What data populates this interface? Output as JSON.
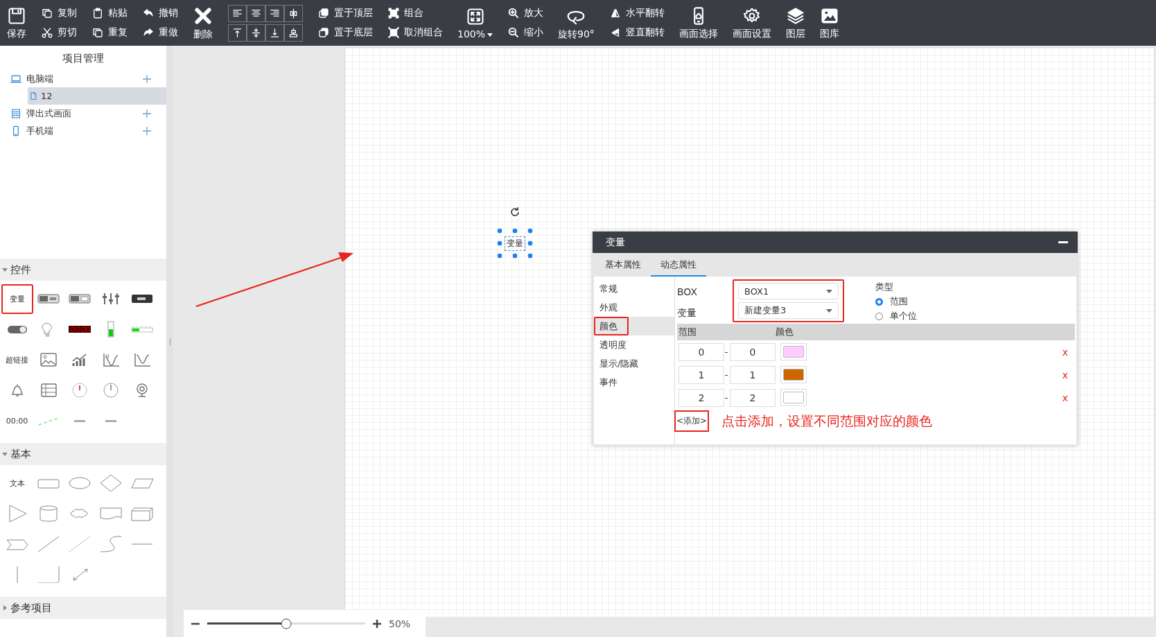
{
  "toolbar": {
    "groups": [
      {
        "kind": "big",
        "items": [
          {
            "label": "保存",
            "kind": "save"
          }
        ]
      },
      {
        "kind": "pair",
        "items": [
          {
            "label": "复制",
            "kind": "copy"
          },
          {
            "label": "剪切",
            "kind": "cut"
          }
        ]
      },
      {
        "kind": "pair",
        "items": [
          {
            "label": "粘贴",
            "kind": "paste"
          },
          {
            "label": "重复",
            "kind": "duplicate"
          }
        ]
      },
      {
        "kind": "pair",
        "items": [
          {
            "label": "撤销",
            "kind": "undo"
          },
          {
            "label": "重做",
            "kind": "redo"
          }
        ]
      },
      {
        "kind": "big",
        "items": [
          {
            "label": "删除",
            "kind": "delete"
          }
        ]
      },
      {
        "kind": "align",
        "items": [
          {
            "kind": "align-left"
          },
          {
            "kind": "align-center"
          },
          {
            "kind": "align-right"
          },
          {
            "kind": "align-hdist"
          },
          {
            "kind": "align-top"
          },
          {
            "kind": "align-middle"
          },
          {
            "kind": "align-bottom"
          },
          {
            "kind": "align-vdist"
          }
        ]
      },
      {
        "kind": "pair",
        "items": [
          {
            "label": "置于顶层",
            "kind": "bring-front"
          },
          {
            "label": "置于底层",
            "kind": "send-back"
          }
        ]
      },
      {
        "kind": "pair",
        "items": [
          {
            "label": "组合",
            "kind": "group"
          },
          {
            "label": "取消组合",
            "kind": "ungroup"
          }
        ]
      },
      {
        "kind": "big",
        "items": [
          {
            "label": "100%",
            "kind": "fit",
            "dropdown": true
          }
        ]
      },
      {
        "kind": "pair",
        "items": [
          {
            "label": "放大",
            "kind": "zoom-in"
          },
          {
            "label": "缩小",
            "kind": "zoom-out"
          }
        ]
      },
      {
        "kind": "big",
        "items": [
          {
            "label": "旋转90°",
            "kind": "rotate"
          }
        ]
      },
      {
        "kind": "pair",
        "items": [
          {
            "label": "水平翻转",
            "kind": "flip-h"
          },
          {
            "label": "竖直翻转",
            "kind": "flip-v"
          }
        ]
      },
      {
        "kind": "big",
        "items": [
          {
            "label": "画面选择",
            "kind": "phone"
          }
        ]
      },
      {
        "kind": "big",
        "items": [
          {
            "label": "画面设置",
            "kind": "gear"
          }
        ]
      },
      {
        "kind": "big",
        "items": [
          {
            "label": "图层",
            "kind": "layers"
          }
        ]
      },
      {
        "kind": "big",
        "items": [
          {
            "label": "图库",
            "kind": "gallery"
          }
        ]
      }
    ]
  },
  "sidebar": {
    "title": "项目管理",
    "tree": [
      {
        "label": "电脑端",
        "kind": "desktop",
        "add_button": true,
        "children": [
          {
            "label": "12",
            "kind": "page",
            "selected": true
          }
        ]
      },
      {
        "label": "弹出式画面",
        "kind": "popup",
        "add_button": true
      },
      {
        "label": "手机端",
        "kind": "mobile",
        "add_button": true
      }
    ],
    "sections": [
      {
        "title": "控件",
        "expanded": true,
        "items": [
          {
            "kind": "text",
            "label": "变量",
            "highlighted": true
          },
          {
            "kind": "bit-lamp"
          },
          {
            "kind": "number-display"
          },
          {
            "kind": "sliders"
          },
          {
            "kind": "image-button"
          },
          {
            "kind": "toggle"
          },
          {
            "kind": "bulb"
          },
          {
            "kind": "led-digits"
          },
          {
            "kind": "thermometer"
          },
          {
            "kind": "bar-meter"
          },
          {
            "kind": "text",
            "label": "超链接",
            "highlighted": false
          },
          {
            "kind": "image"
          },
          {
            "kind": "trend"
          },
          {
            "kind": "curve"
          },
          {
            "kind": "curve2"
          },
          {
            "kind": "bell"
          },
          {
            "kind": "table"
          },
          {
            "kind": "gauge"
          },
          {
            "kind": "clock"
          },
          {
            "kind": "webcam"
          },
          {
            "kind": "text",
            "label": "00:00",
            "highlighted": false
          },
          {
            "kind": "dash-line"
          },
          {
            "kind": "tiny-text"
          },
          {
            "kind": "tiny-text"
          }
        ]
      },
      {
        "title": "基本",
        "expanded": true,
        "items": [
          {
            "kind": "text",
            "label": "文本",
            "highlighted": false
          },
          {
            "kind": "rect"
          },
          {
            "kind": "ellipse"
          },
          {
            "kind": "diamond"
          },
          {
            "kind": "parallelogram"
          },
          {
            "kind": "triangle"
          },
          {
            "kind": "cylinder"
          },
          {
            "kind": "cloud"
          },
          {
            "kind": "document"
          },
          {
            "kind": "cube"
          },
          {
            "kind": "chevron"
          },
          {
            "kind": "line"
          },
          {
            "kind": "dotted-line"
          },
          {
            "kind": "curve-line"
          },
          {
            "kind": "hline"
          },
          {
            "kind": "vline"
          },
          {
            "kind": "corner"
          },
          {
            "kind": "double-arrow"
          }
        ]
      },
      {
        "title": "参考项目",
        "expanded": false
      }
    ]
  },
  "canvas": {
    "widget": {
      "label": "变量",
      "selected": true
    }
  },
  "zoom_bar": {
    "level": 0.5,
    "reading": "50%"
  },
  "dialog": {
    "title": "变量",
    "tabs": [
      {
        "label": "基本属性",
        "selected": false
      },
      {
        "label": "动态属性",
        "selected": true
      }
    ],
    "menu": [
      {
        "label": "常规",
        "selected": false,
        "highlighted": false
      },
      {
        "label": "外观",
        "selected": false,
        "highlighted": false
      },
      {
        "label": "颜色",
        "selected": true,
        "highlighted": true
      },
      {
        "label": "透明度",
        "selected": false,
        "highlighted": false
      },
      {
        "label": "显示/隐藏",
        "selected": false,
        "highlighted": false
      },
      {
        "label": "事件",
        "selected": false,
        "highlighted": false
      }
    ],
    "fields": [
      {
        "label": "BOX",
        "value": "BOX1"
      },
      {
        "label": "变量",
        "value": "新建变量3"
      }
    ],
    "fields_highlighted": true,
    "type": {
      "label": "类型",
      "options": [
        {
          "label": "范围",
          "selected": true
        },
        {
          "label": "单个位",
          "selected": false
        }
      ]
    },
    "table": {
      "columns": [
        "范围",
        "颜色"
      ],
      "rows": [
        {
          "from": "0",
          "dash": "-",
          "to": "0",
          "color": "#ffccff",
          "delete": "x"
        },
        {
          "from": "1",
          "dash": "-",
          "to": "1",
          "color": "#cc6600",
          "delete": "x"
        },
        {
          "from": "2",
          "dash": "-",
          "to": "2",
          "color": "#ffffff",
          "delete": "x"
        }
      ]
    },
    "add_link": {
      "label": "<添加>",
      "highlighted": true
    },
    "annotation": "点击添加，设置不同范围对应的颜色"
  }
}
